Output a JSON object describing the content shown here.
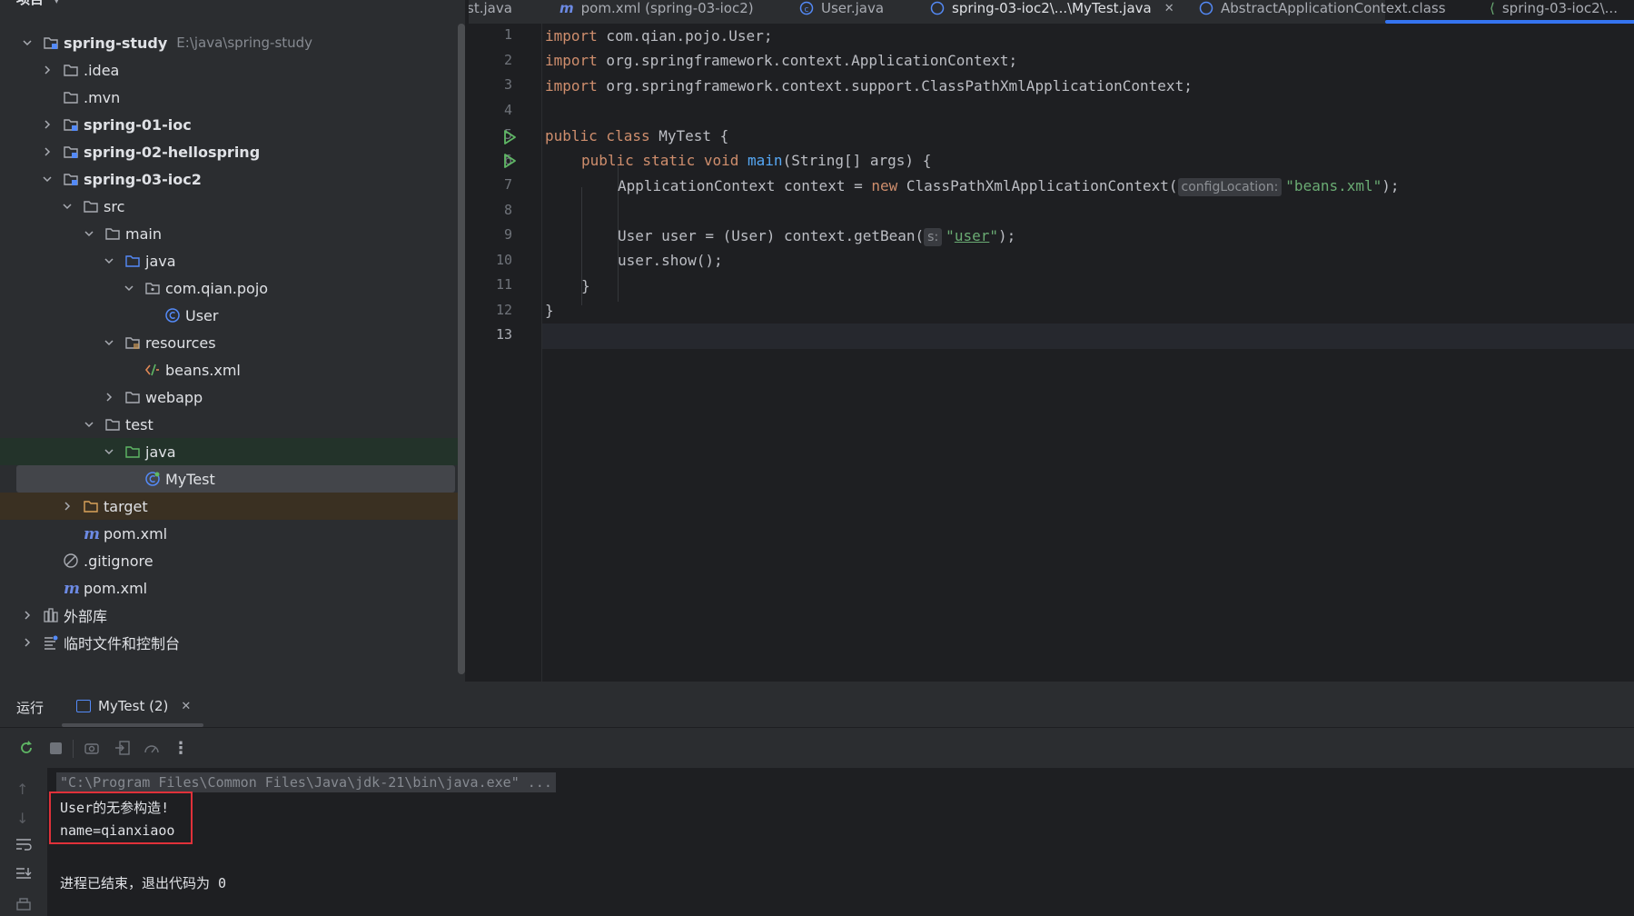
{
  "project": {
    "header": "项目",
    "tree": [
      {
        "label": "spring-study",
        "path": "E:\\java\\spring-study",
        "bold": true,
        "icon": "module-folder-icon",
        "chev": "down"
      },
      {
        "label": ".idea",
        "icon": "folder-icon",
        "chev": "right"
      },
      {
        "label": ".mvn",
        "icon": "folder-icon",
        "chev": ""
      },
      {
        "label": "spring-01-ioc",
        "bold": true,
        "icon": "module-folder-icon",
        "chev": "right"
      },
      {
        "label": "spring-02-hellospring",
        "bold": true,
        "icon": "module-folder-icon",
        "chev": "right"
      },
      {
        "label": "spring-03-ioc2",
        "bold": true,
        "icon": "module-folder-icon",
        "chev": "down"
      },
      {
        "label": "src",
        "icon": "folder-icon",
        "chev": "down"
      },
      {
        "label": "main",
        "icon": "folder-icon",
        "chev": "down"
      },
      {
        "label": "java",
        "icon": "source-folder-icon",
        "chev": "down"
      },
      {
        "label": "com.qian.pojo",
        "icon": "package-icon",
        "chev": "down"
      },
      {
        "label": "User",
        "icon": "class-icon",
        "chev": ""
      },
      {
        "label": "resources",
        "icon": "resources-folder-icon",
        "chev": "down"
      },
      {
        "label": "beans.xml",
        "icon": "xml-file-icon",
        "chev": ""
      },
      {
        "label": "webapp",
        "icon": "folder-icon",
        "chev": "right"
      },
      {
        "label": "test",
        "icon": "folder-icon",
        "chev": "down"
      },
      {
        "label": "java",
        "icon": "test-folder-icon",
        "chev": "down"
      },
      {
        "label": "MyTest",
        "icon": "test-class-icon",
        "chev": ""
      },
      {
        "label": "target",
        "icon": "excluded-folder-icon",
        "chev": "right"
      },
      {
        "label": "pom.xml",
        "icon": "maven-icon",
        "chev": ""
      },
      {
        "label": ".gitignore",
        "icon": "ignore-file-icon",
        "chev": ""
      },
      {
        "label": "pom.xml",
        "icon": "maven-icon",
        "chev": ""
      },
      {
        "label": "外部库",
        "icon": "library-icon",
        "chev": "right"
      },
      {
        "label": "临时文件和控制台",
        "icon": "scratch-icon",
        "chev": "right"
      }
    ]
  },
  "tabs": [
    {
      "label": "st.java"
    },
    {
      "label": "pom.xml (spring-03-ioc2)"
    },
    {
      "label": "User.java"
    },
    {
      "label": "spring-03-ioc2\\...\\MyTest.java"
    },
    {
      "label": "AbstractApplicationContext.class"
    },
    {
      "label": "spring-03-ioc2\\..."
    }
  ],
  "editor": {
    "line_numbers": [
      "1",
      "2",
      "3",
      "4",
      "5",
      "6",
      "7",
      "8",
      "9",
      "10",
      "11",
      "12",
      "13"
    ],
    "lines": {
      "l1_kw": "import",
      "l1_rest": " com.qian.pojo.User;",
      "l2_kw": "import",
      "l2_rest": " org.springframework.context.ApplicationContext;",
      "l3_kw": "import",
      "l3_rest": " org.springframework.context.support.ClassPathXmlApplicationContext;",
      "l5_kw1": "public",
      "l5_kw2": " class",
      "l5_rest": " MyTest {",
      "l6_kw": "public static void",
      "l6_fn": "main",
      "l6_rest": "(String[] args) {",
      "l7_a": "ApplicationContext context = ",
      "l7_kw": "new",
      "l7_b": " ClassPathXmlApplicationContext(",
      "l7_hint": "configLocation:",
      "l7_str": "\"beans.xml\"",
      "l7_end": ");",
      "l9_a": "User user = (User) context.getBean(",
      "l9_hint": "s:",
      "l9_q1": "\"",
      "l9_str": "user",
      "l9_q2": "\"",
      "l9_end": ");",
      "l10": "user.show();",
      "l11": "}",
      "l12": "}"
    }
  },
  "run": {
    "label": "运行",
    "tab": "MyTest (2)",
    "console": [
      "\"C:\\Program Files\\Common Files\\Java\\jdk-21\\bin\\java.exe\" ...",
      "User的无参构造!",
      "name=qianxiaoo",
      "进程已结束，退出代码为 0"
    ]
  }
}
